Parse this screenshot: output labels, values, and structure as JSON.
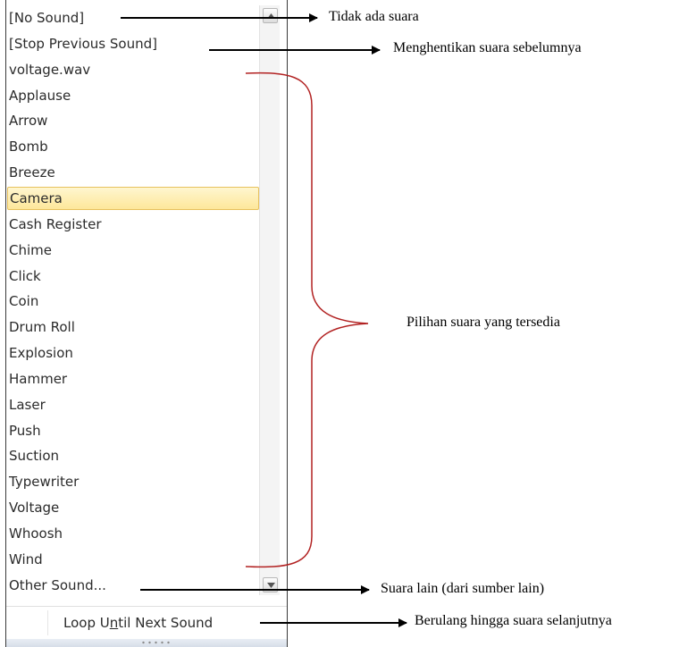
{
  "menu": {
    "items": [
      "[No Sound]",
      "[Stop Previous Sound]",
      "voltage.wav",
      "Applause",
      "Arrow",
      "Bomb",
      "Breeze",
      "Camera",
      "Cash Register",
      "Chime",
      "Click",
      "Coin",
      "Drum Roll",
      "Explosion",
      "Hammer",
      "Laser",
      "Push",
      "Suction",
      "Typewriter",
      "Voltage",
      "Whoosh",
      "Wind",
      "Other Sound..."
    ],
    "selected_item": "Camera",
    "loop_label_pre": "Loop U",
    "loop_label_accel": "n",
    "loop_label_post": "til Next Sound"
  },
  "annotations": {
    "no_sound": "Tidak ada suara",
    "stop_previous": "Menghentikan suara sebelumnya",
    "available_sounds": "Pilihan suara yang tersedia",
    "other_sound": "Suara lain (dari sumber lain)",
    "loop": "Berulang hingga suara selanjutnya"
  },
  "icons": {
    "scroll_up": "scroll-up-arrow-icon",
    "scroll_down": "scroll-down-arrow-icon",
    "resize_grip": "resize-grip-icon",
    "arrow": "right-arrow-icon",
    "brace": "curly-brace-icon"
  },
  "colors": {
    "selected_fill": "#fde79a",
    "selected_border": "#e7c15e",
    "brace": "#b22222",
    "arrow": "#000000"
  }
}
